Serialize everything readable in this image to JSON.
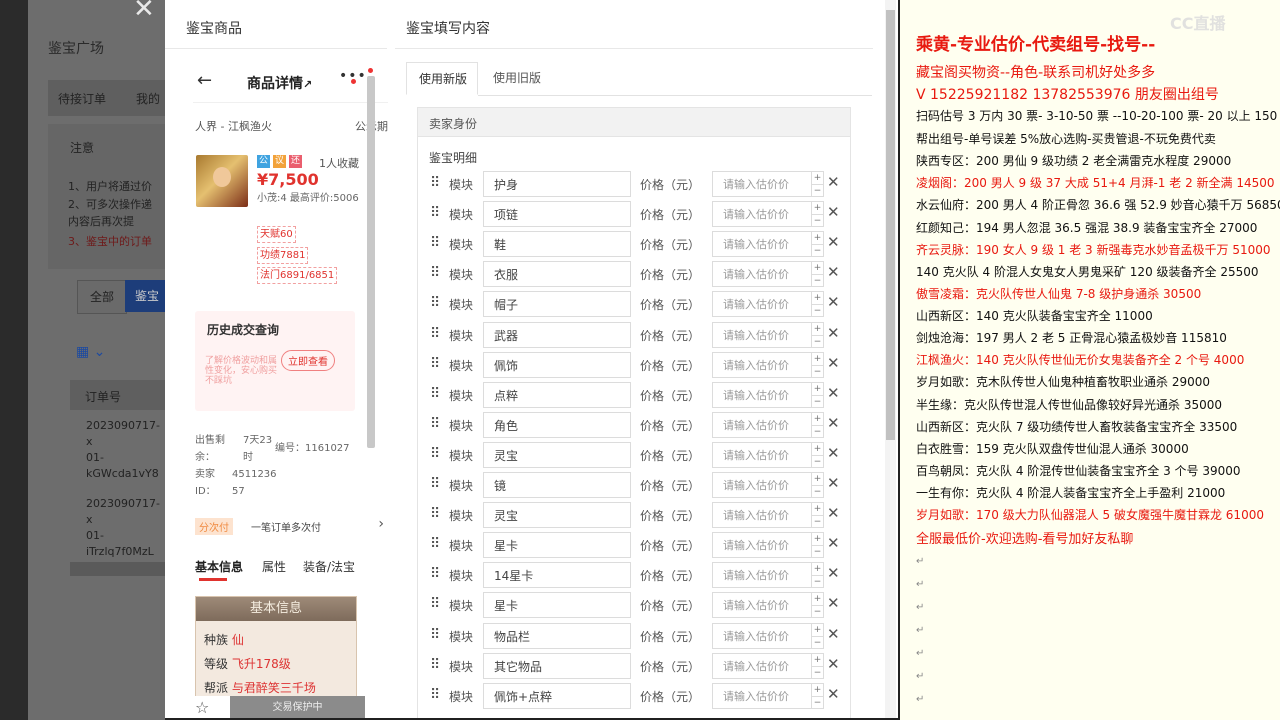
{
  "background_page": {
    "title": "鉴宝广场",
    "tabs": [
      "待接订单",
      "我的"
    ],
    "notice_heading": "注意",
    "notice_lines": [
      "1、用户将通过价",
      "2、可多次操作递",
      "内容后再次提",
      "3、鉴宝中的订单"
    ],
    "filter_all": "全部",
    "filter_selected": "鉴宝",
    "table_header": "订单号",
    "rows": [
      [
        "2023090717-x",
        "01-",
        "kGWcda1vY8"
      ],
      [
        "2023090717-x",
        "01-",
        "iTrzlq7f0MzL"
      ]
    ]
  },
  "modal": {
    "left_title": "鉴宝商品",
    "right_title": "鉴宝填写内容"
  },
  "phone": {
    "page_title": "商品详情",
    "server": "人界 - 江枫渔火",
    "status": "公示期",
    "badges": [
      "公",
      "议",
      "还"
    ],
    "favorites": "1人收藏",
    "price": "¥7,500",
    "desc": "小茂:4 最高评价:5006",
    "tags": [
      "天赋60",
      "功绩7881",
      "法门6891/6851"
    ],
    "history_title": "历史成交查询",
    "history_desc": "了解价格波动和属性变化，安心购买不踩坑",
    "history_button": "立即查看",
    "meta_left": [
      "出售剩余：",
      "卖家ID：",
      "4511236",
      "57"
    ],
    "meta_time": "7天23时",
    "meta_id": "编号：1161027",
    "pay_badge": "分次付",
    "pay_text": "一笔订单多次付",
    "tabs": [
      "基本信息",
      "属性",
      "装备/法宝"
    ],
    "info_card_title": "基本信息",
    "info_rows": [
      [
        "种族",
        "仙"
      ],
      [
        "等级",
        "飞升178级"
      ],
      [
        "帮派",
        "与君醉笑三千场"
      ]
    ],
    "guard_label": "交易保护中"
  },
  "form": {
    "version_tabs": [
      "使用新版",
      "使用旧版"
    ],
    "section_label": "卖家身份",
    "detail_label": "鉴宝明细",
    "module_label": "模块",
    "price_label": "价格（元）",
    "price_placeholder": "请输入估价价",
    "items": [
      "护身",
      "项链",
      "鞋",
      "衣服",
      "帽子",
      "武器",
      "佩饰",
      "点粹",
      "角色",
      "灵宝",
      "镜",
      "灵宝",
      "星卡",
      "14星卡",
      "星卡",
      "物品栏",
      "其它物品",
      "佩饰+点粹"
    ]
  },
  "notes": {
    "watermark": "CC直播",
    "lines": [
      {
        "text": "乘黄-专业估价-代卖组号-找号--",
        "color": "#e8190f"
      },
      {
        "text": "藏宝阁买物资--角色-联系司机好处多多",
        "color": "#e8190f"
      },
      {
        "text": "V 15225921182   13782553976 朋友圈出组号",
        "color": "#e8190f"
      },
      {
        "text": "扫码估号 3 万内 30 票- 3-10-50 票  --10-20-100 票- 20 以上 150",
        "color": "#111111"
      },
      {
        "text": "帮出组号-单号误差 5%放心选购-买贵管退-不玩免费代卖",
        "color": "#111111"
      },
      {
        "text": "陕西专区：200 男仙 9 级功绩 2 老全满雷克水程度 29000",
        "color": "#111111"
      },
      {
        "text": "凌烟阁：200 男人 9 级 37 大成 51+4 月湃-1 老 2 新全满 14500",
        "color": "#e8190f"
      },
      {
        "text": "水云仙府：200 男人 4 阶正骨忽 36.6 强 52.9 妙音心猿千万 56850",
        "color": "#111111"
      },
      {
        "text": "红颜知己：194 男人忽混 36.5 强混 38.9 装备宝宝齐全 27000",
        "color": "#111111"
      },
      {
        "text": "齐云灵脉：190 女人 9 级 1 老 3 新强毒克水妙音孟极千万 51000",
        "color": "#e8190f"
      },
      {
        "text": "140 克火队 4 阶混人女鬼女人男鬼采矿 120 级装备齐全 25500",
        "color": "#111111"
      },
      {
        "text": "傲雪凌霜：克火队传世人仙鬼 7-8 级护身通杀 30500",
        "color": "#e8190f"
      },
      {
        "text": "山西新区：140 克火队装备宝宝齐全 11000",
        "color": "#111111"
      },
      {
        "text": "剑烛沧海：197 男人 2 老 5 正骨混心猿孟极妙音 115810",
        "color": "#111111"
      },
      {
        "text": "江枫渔火：140 克火队传世仙无价女鬼装备齐全 2 个号 4000",
        "color": "#e8190f"
      },
      {
        "text": "岁月如歌：克木队传世人仙鬼种植畜牧职业通杀 29000",
        "color": "#111111"
      },
      {
        "text": "半生缘：克火队传世混人传世仙品像较好异光通杀 35000",
        "color": "#111111"
      },
      {
        "text": "山西新区：克火队 7 级功绩传世人畜牧装备宝宝齐全 33500",
        "color": "#111111"
      },
      {
        "text": "白衣胜雪：159 克火队双盘传世仙混人通杀 30000",
        "color": "#111111"
      },
      {
        "text": "百鸟朝凤：克火队 4 阶混传世仙装备宝宝齐全 3 个号 39000",
        "color": "#111111"
      },
      {
        "text": "一生有你：克火队 4 阶混人装备宝宝齐全上手盈利 21000",
        "color": "#111111"
      },
      {
        "text": "岁月如歌：170 级大力队仙器混人 5 破女魔强牛魔甘霖龙 61000",
        "color": "#e8190f"
      },
      {
        "text": "全服最低价-欢迎选购-看号加好友私聊",
        "color": "#e8190f"
      }
    ]
  }
}
